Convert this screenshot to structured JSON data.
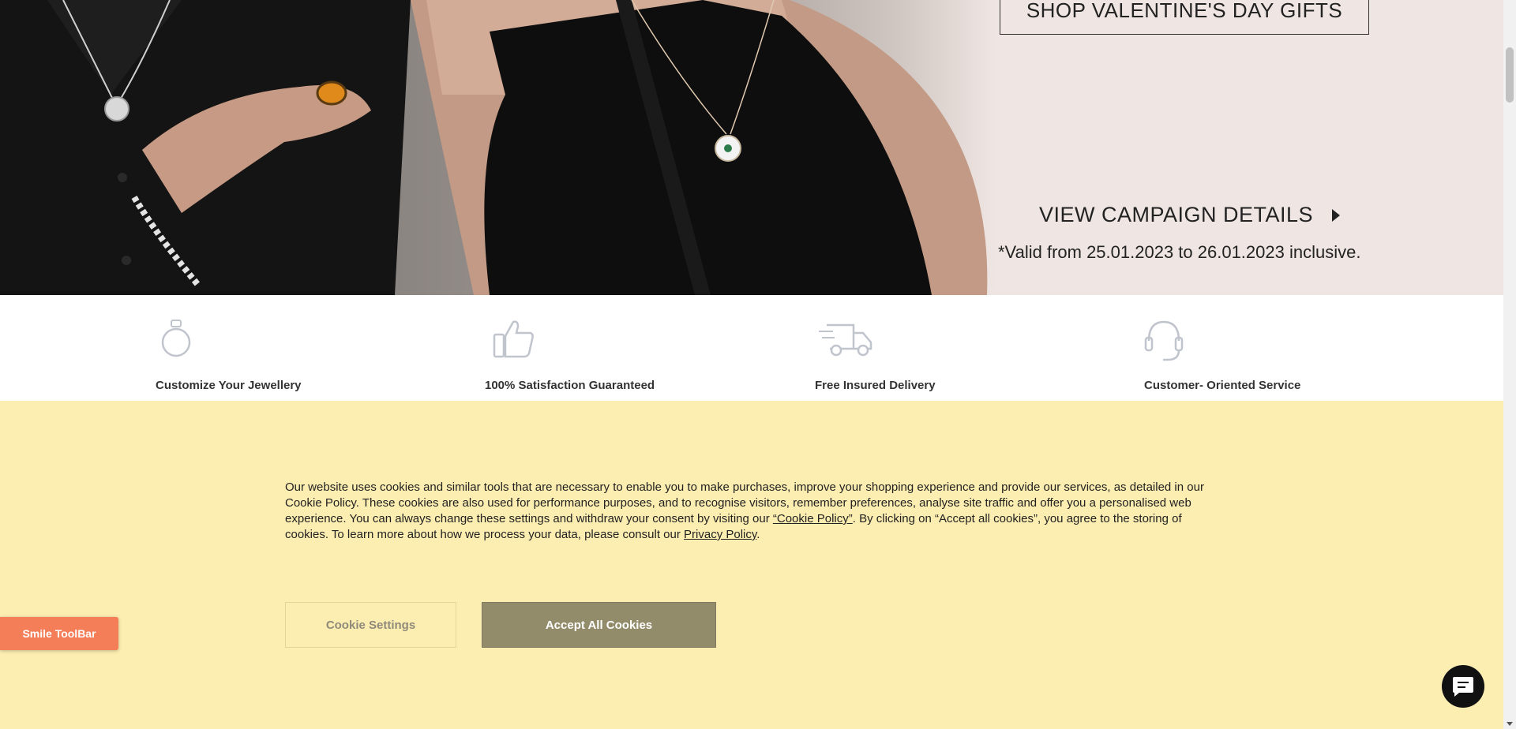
{
  "hero": {
    "shop_button": "SHOP VALENTINE'S DAY GIFTS",
    "campaign_link": "VIEW CAMPAIGN DETAILS",
    "valid_text": "*Valid from 25.01.2023 to 26.01.2023 inclusive."
  },
  "features": [
    {
      "label": "Customize Your Jewellery",
      "icon": "ring-icon"
    },
    {
      "label": "100% Satisfaction Guaranteed",
      "icon": "thumbs-up-icon"
    },
    {
      "label": "Free Insured Delivery",
      "icon": "delivery-truck-icon"
    },
    {
      "label": "Customer- Oriented Service",
      "icon": "headset-icon"
    }
  ],
  "cookie": {
    "text_part1": "Our website uses cookies and similar tools that are necessary to enable you to make purchases, improve your shopping experience and provide our services, as detailed in our Cookie Policy. These cookies are also used for performance purposes, and to recognise visitors, remember preferences, analyse site traffic and offer you a personalised web experience. You can always change these settings and withdraw your consent by visiting our ",
    "cookie_policy_link": "“Cookie Policy”",
    "text_part2": ". By clicking on “Accept all cookies”, you agree to the storing of cookies. To learn more about how we process your data, please consult our ",
    "privacy_policy_link": "Privacy Policy",
    "text_part3": ".",
    "settings_button": "Cookie Settings",
    "accept_button": "Accept All Cookies"
  },
  "smile_toolbar": {
    "label": "Smile ToolBar"
  },
  "colors": {
    "cookie_bg": "#fcedb1",
    "accept_bg": "#938c6b",
    "smile_bg": "#f47e58",
    "hero_bg": "#efe6e3"
  }
}
